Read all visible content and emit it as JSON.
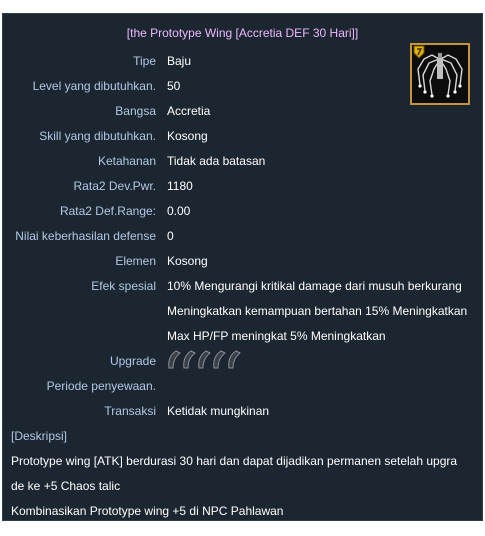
{
  "item": {
    "title": "[the Prototype Wing [Accretia DEF 30 Hari]]",
    "icon": "wing-armor-icon",
    "fields": [
      {
        "label": "Tipe",
        "value": "Baju"
      },
      {
        "label": "Level yang dibutuhkan.",
        "value": "50"
      },
      {
        "label": "Bangsa",
        "value": "Accretia"
      },
      {
        "label": "Skill yang dibutuhkan.",
        "value": "Kosong"
      },
      {
        "label": "Ketahanan",
        "value": "Tidak ada batasan"
      },
      {
        "label": "Rata2 Dev.Pwr.",
        "value": "1180"
      },
      {
        "label": "Rata2 Def.Range:",
        "value": "0.00"
      },
      {
        "label": "Nilai keberhasilan defense",
        "value": "0"
      },
      {
        "label": "Elemen",
        "value": "Kosong"
      }
    ],
    "special_effect": {
      "label": "Efek spesial",
      "lines": [
        "10% Mengurangi kritikal damage dari musuh berkurang",
        "Meningkatkan kemampuan bertahan 15% Meningkatkan",
        "Max HP/FP meningkat 5% Meningkatkan"
      ]
    },
    "upgrade": {
      "label": "Upgrade",
      "slots": 5,
      "slot_icon": "talic-slot-icon"
    },
    "rental_period": {
      "label": "Periode penyewaan.",
      "value": ""
    },
    "trade": {
      "label": "Transaksi",
      "value": "Ketidak mungkinan"
    },
    "description": {
      "heading": "[Deskripsi]",
      "lines": [
        "Prototype wing [ATK] berdurasi 30 hari dan dapat dijadikan permanen setelah upgra",
        "de ke +5 Chaos talic",
        "Kombinasikan Prototype wing +5 di NPC Pahlawan"
      ]
    }
  },
  "colors": {
    "background": "#1b2631",
    "title": "#f0b8ff",
    "label": "#b3c8e6",
    "value": "#ffffff",
    "icon_border": "#c79535"
  }
}
